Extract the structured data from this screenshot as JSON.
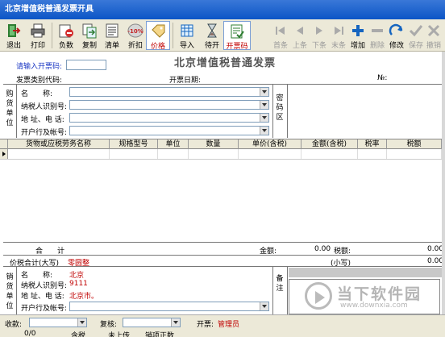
{
  "window": {
    "title": "北京增值税普通发票开具"
  },
  "toolbar": {
    "exit": "退出",
    "print": "打印",
    "negative": "负数",
    "copy": "复制",
    "list": "清单",
    "discount": "折扣",
    "discount_badge": "-10%",
    "price": "价格",
    "import": "导入",
    "hold": "待开",
    "issue": "开票码",
    "first": "首条",
    "prev": "上条",
    "next": "下条",
    "last": "末条",
    "add": "增加",
    "delete": "删除",
    "modify": "修改",
    "save": "保存",
    "cancel": "撤销"
  },
  "invoice": {
    "title": "北京增值税普通发票",
    "prompt_label": "请输入开票码:",
    "type_code_label": "发票类别代码:",
    "date_label": "开票日期:",
    "number_label": "№:",
    "buyer_title": "购货单位",
    "password_title": "密码区",
    "buyer": {
      "name_label": "名　　称:",
      "taxid_label": "纳税人识别号:",
      "address_label": "地 址、电 话:",
      "bank_label": "开户行及帐号:"
    }
  },
  "grid": {
    "columns": [
      "货物或应税劳务名称",
      "规格型号",
      "单位",
      "数量",
      "单价(含税)",
      "金额(含税)",
      "税率",
      "税额"
    ]
  },
  "totals": {
    "total_label": "合　　计",
    "amount_label": "金额:",
    "amount_value": "0.00",
    "tax_label": "税额:",
    "tax_value": "0.00",
    "sum_caps_label": "价税合计(大写)",
    "sum_caps_value": "零圆整",
    "sum_small_label": "(小写)",
    "sum_small_value": "0.00"
  },
  "seller": {
    "title": "销货单位",
    "remarks_title": "备注",
    "name_label": "名　　称:",
    "name_value": "北京",
    "taxid_label": "纳税人识别号:",
    "taxid_value": "9111",
    "address_label": "地 址、电 话:",
    "address_value": "北京市。",
    "bank_label": "开户行及帐号:"
  },
  "footer": {
    "payee_label": "收款:",
    "reviewer_label": "复核:",
    "issuer_label": "开票:",
    "issuer_value": "管理员",
    "status_count": "0/0",
    "status_tax_included": "含税",
    "status_not_uploaded": "未上传",
    "status_rows": "销项正数"
  },
  "watermark": {
    "cn": "当下软件园",
    "en": "www.downxia.com"
  }
}
